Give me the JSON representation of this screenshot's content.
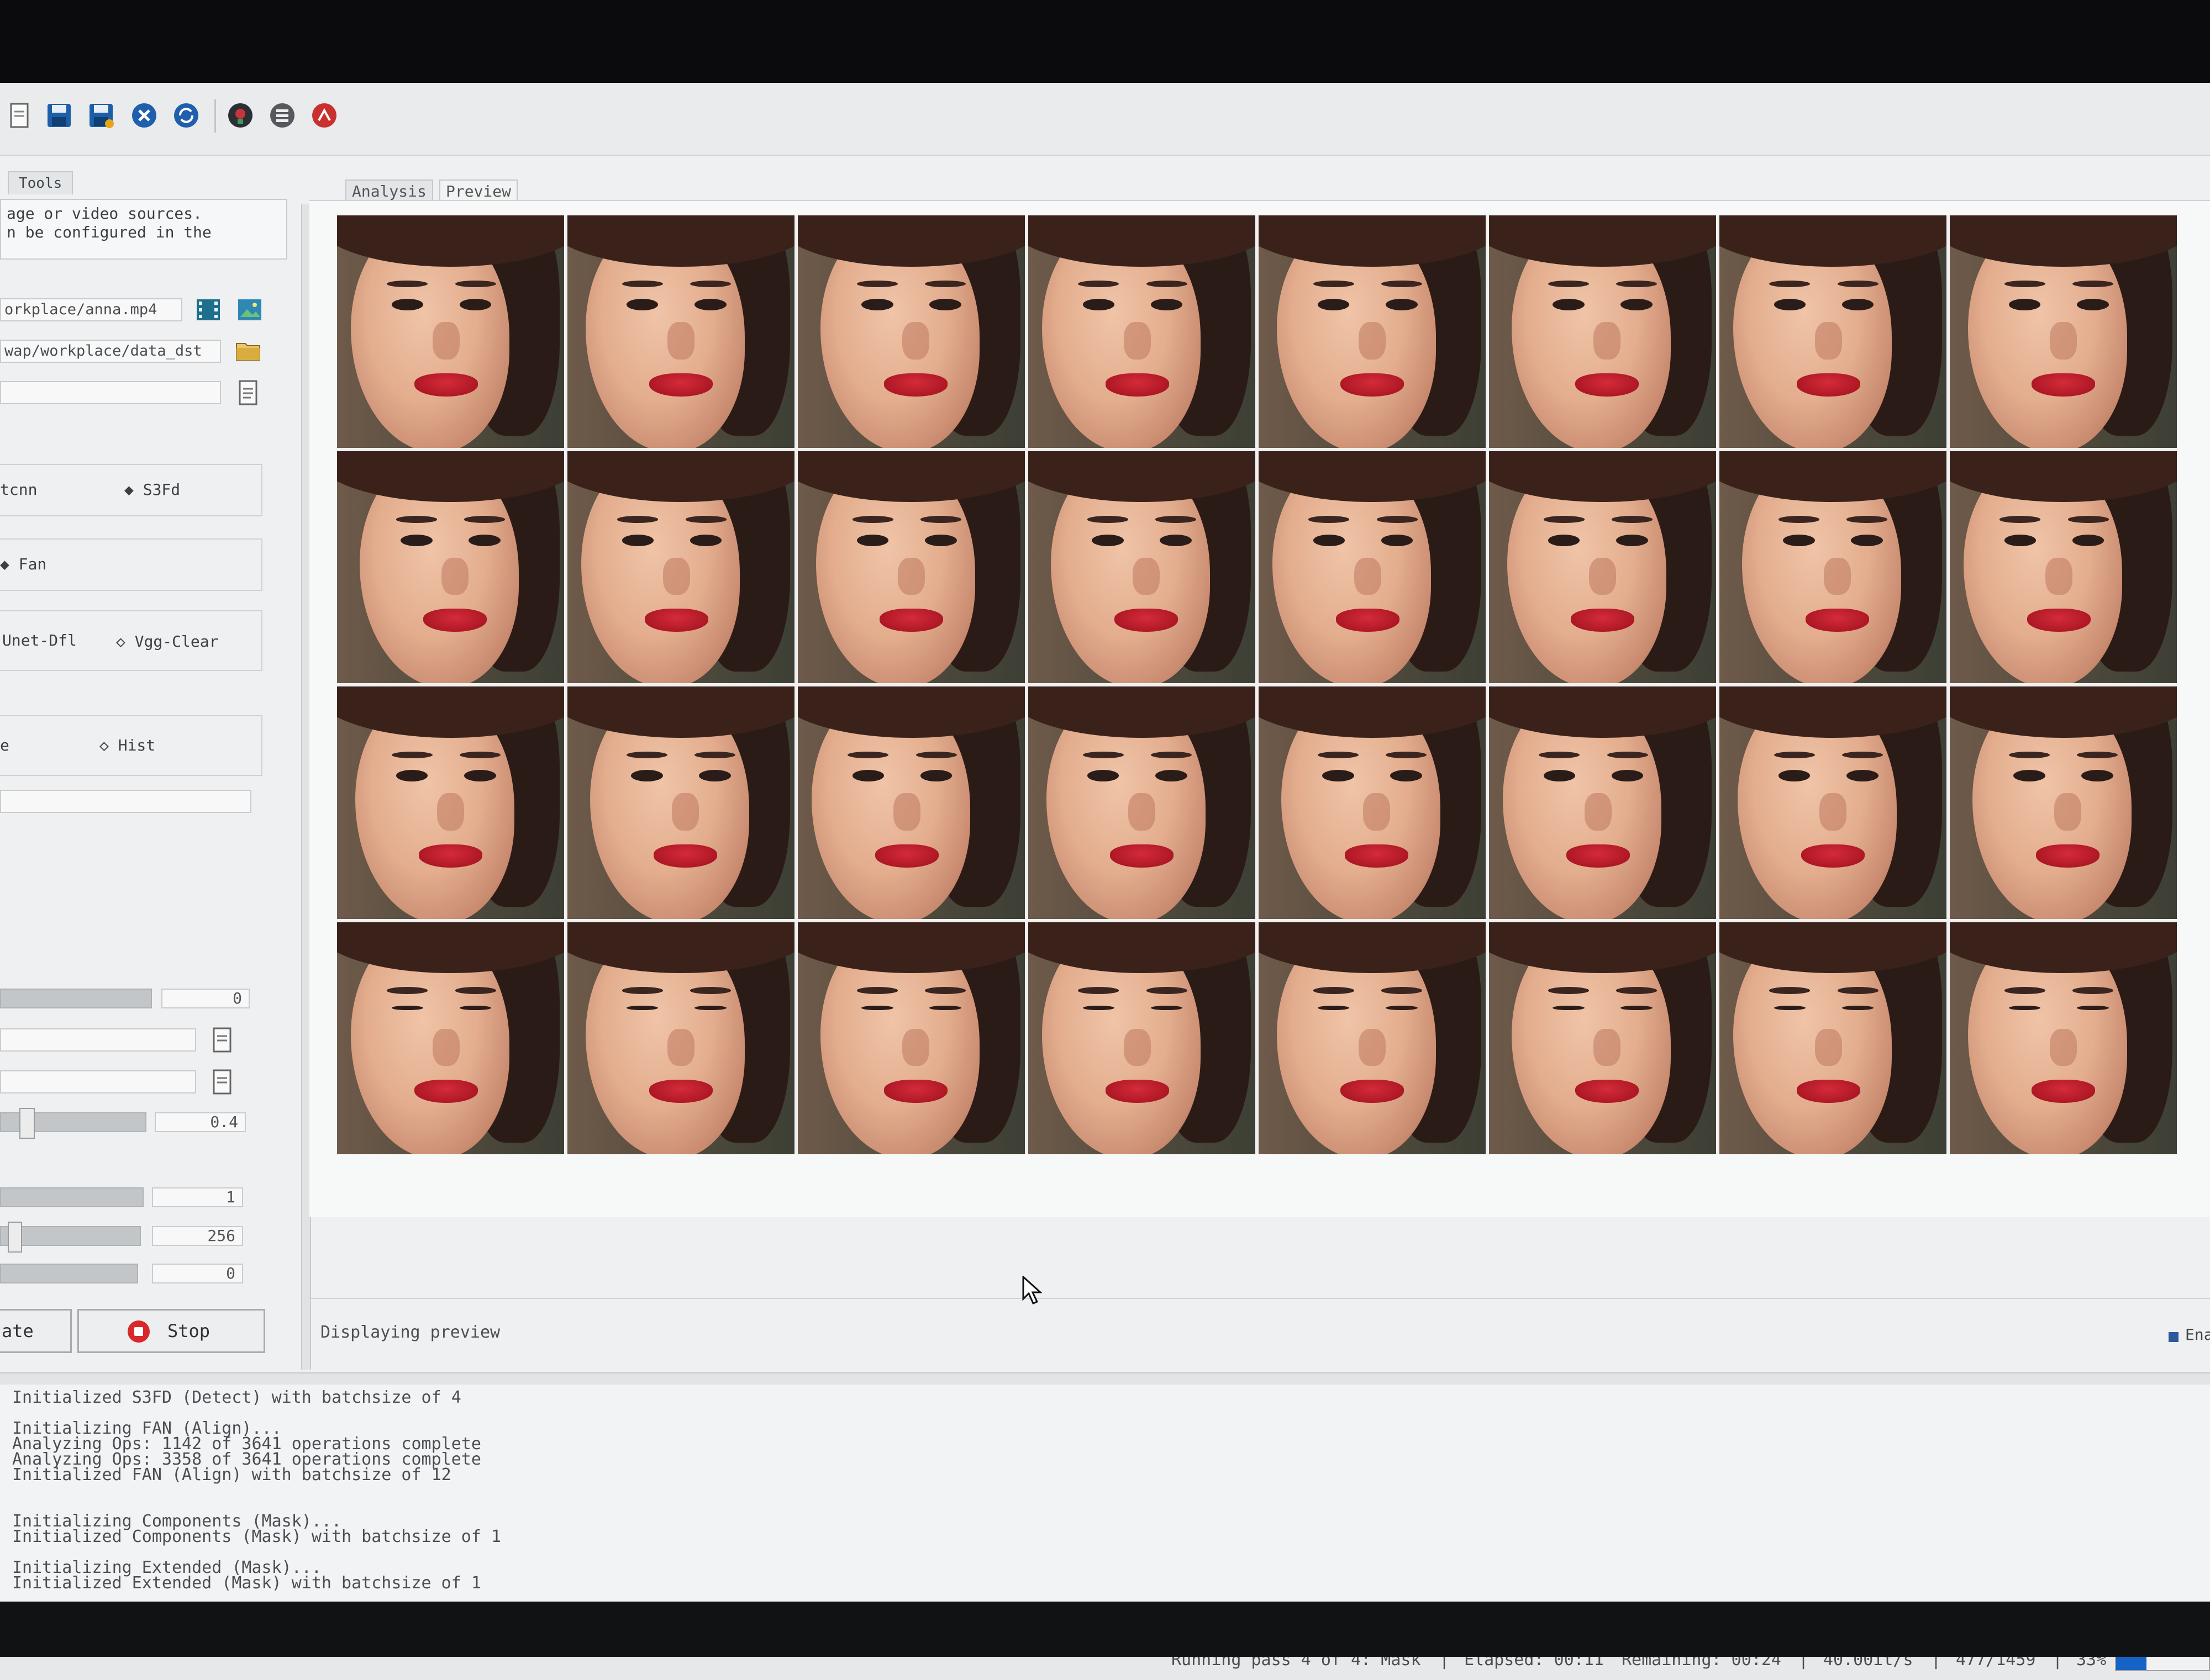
{
  "toolbar": {
    "buttons": [
      "new-file-icon",
      "save-icon",
      "save-as-icon",
      "clear-icon",
      "reload-icon",
      "train-icon",
      "extract-icon",
      "convert-icon"
    ]
  },
  "left_tabs": [
    "Tools"
  ],
  "description": "age or video sources.\nn be configured in the",
  "fields": {
    "input_path": "orkplace/anna.mp4",
    "output_path": "wap/workplace/data_dst",
    "alignments_path": ""
  },
  "detector": {
    "option_a": "tcnn",
    "option_b": "S3Fd",
    "selected": "S3Fd"
  },
  "aligner": {
    "option_a": "Fan",
    "selected": "Fan"
  },
  "masker": {
    "option_a": "Unet-Dfl",
    "option_b": "Vgg-Clear"
  },
  "normalization": {
    "option_a": "e",
    "option_b": "Hist"
  },
  "sliders": {
    "s1_value": "0",
    "s2_value": "0.4",
    "s3_value": "1",
    "s4_value": "256",
    "s5_value": "0"
  },
  "actions": {
    "left_label": "ate",
    "stop_label": "Stop"
  },
  "right_tabs": {
    "analysis": "Analysis",
    "preview": "Preview"
  },
  "preview_status": "Displaying preview",
  "enable_label": "Ena",
  "console": [
    "Initialized S3FD (Detect) with batchsize of 4",
    "",
    "Initializing FAN (Align)...",
    "Analyzing Ops: 1142 of 3641 operations complete",
    "Analyzing Ops: 3358 of 3641 operations complete",
    "Initialized FAN (Align) with batchsize of 12",
    "",
    "",
    "Initializing Components (Mask)...",
    "Initialized Components (Mask) with batchsize of 1",
    "",
    "Initializing Extended (Mask)...",
    "Initialized Extended (Mask) with batchsize of 1"
  ],
  "statusbar": {
    "pass": "Running pass 4 of 4: Mask",
    "elapsed": "Elapsed: 00:11",
    "remaining": "Remaining: 00:24",
    "rate": "40.00it/s",
    "count": "477/1459",
    "percent": "33%",
    "progress": 0.33
  },
  "colors": {
    "accent": "#1663c7",
    "stop_red": "#d8282b"
  },
  "face_tiles": 32
}
